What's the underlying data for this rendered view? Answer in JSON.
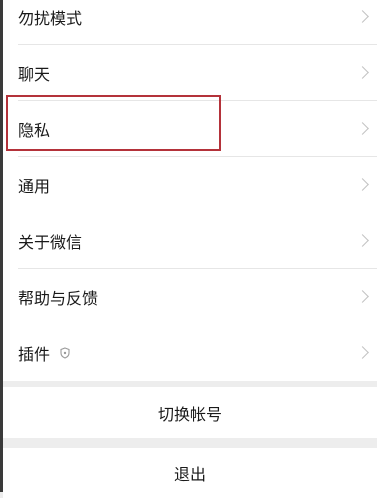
{
  "settings": {
    "group1": [
      {
        "label": "勿扰模式"
      },
      {
        "label": "聊天"
      },
      {
        "label": "隐私"
      },
      {
        "label": "通用"
      }
    ],
    "group2": [
      {
        "label": "关于微信"
      },
      {
        "label": "帮助与反馈"
      }
    ],
    "group3": [
      {
        "label": "插件",
        "icon": "shield-icon"
      }
    ]
  },
  "actions": {
    "switch_account": "切换帐号",
    "logout": "退出"
  },
  "colors": {
    "background": "#ededed",
    "card": "#ffffff",
    "highlight": "#b4323a",
    "chevron": "#c2c2c2"
  }
}
